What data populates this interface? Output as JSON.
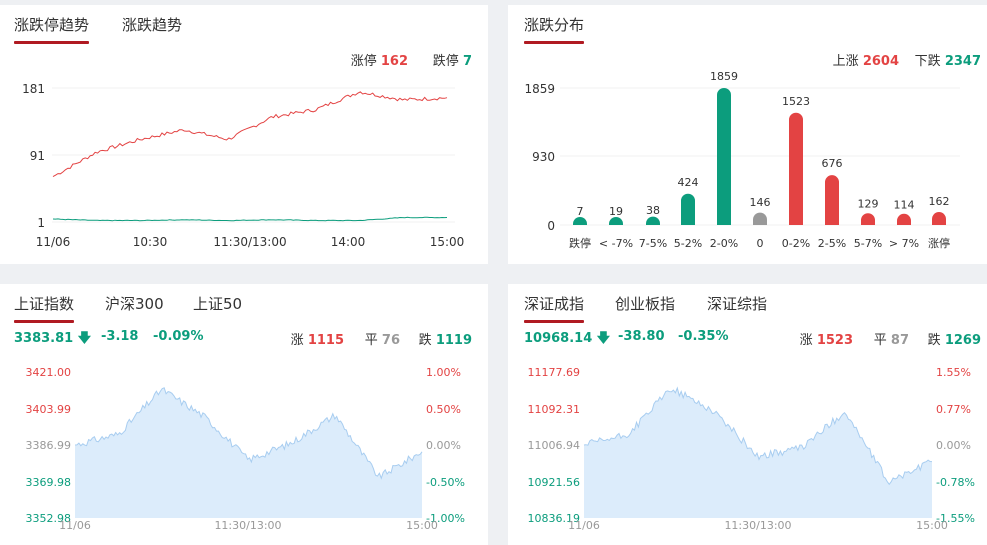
{
  "colors": {
    "red": "#e34343",
    "green": "#0c9d7d",
    "gray": "#999999",
    "accent": "#b01a22",
    "area_fill": "#dcecfb",
    "area_line": "#a8cdf0"
  },
  "limit_trend": {
    "tabs": [
      "涨跌停趋势",
      "涨跌趋势"
    ],
    "up_label": "涨停",
    "up_value": "162",
    "down_label": "跌停",
    "down_value": "7",
    "y_ticks": [
      "181",
      "91",
      "1"
    ],
    "x_ticks": [
      "11/06",
      "10:30",
      "11:30/13:00",
      "14:00",
      "15:00"
    ]
  },
  "distribution": {
    "tab": "涨跌分布",
    "up_label": "上涨",
    "up_value": "2604",
    "down_label": "下跌",
    "down_value": "2347",
    "y_ticks": [
      "1859",
      "930",
      "0"
    ]
  },
  "sh_index": {
    "tabs": [
      "上证指数",
      "沪深300",
      "上证50"
    ],
    "price": "3383.81",
    "change": "-3.18",
    "pct": "-0.09%",
    "up_label": "涨",
    "up_value": "1115",
    "flat_label": "平",
    "flat_value": "76",
    "down_label": "跌",
    "down_value": "1119",
    "left_ticks": [
      "3421.00",
      "3403.99",
      "3386.99",
      "3369.98",
      "3352.98"
    ],
    "right_ticks": [
      "1.00%",
      "0.50%",
      "0.00%",
      "-0.50%",
      "-1.00%"
    ],
    "x_ticks": [
      "11/06",
      "11:30/13:00",
      "15:00"
    ]
  },
  "sz_index": {
    "tabs": [
      "深证成指",
      "创业板指",
      "深证综指"
    ],
    "price": "10968.14",
    "change": "-38.80",
    "pct": "-0.35%",
    "up_label": "涨",
    "up_value": "1523",
    "flat_label": "平",
    "flat_value": "87",
    "down_label": "跌",
    "down_value": "1269",
    "left_ticks": [
      "11177.69",
      "11092.31",
      "11006.94",
      "10921.56",
      "10836.19"
    ],
    "right_ticks": [
      "1.55%",
      "0.77%",
      "0.00%",
      "-0.78%",
      "-1.55%"
    ],
    "x_ticks": [
      "11/06",
      "11:30/13:00",
      "15:00"
    ]
  },
  "chart_data": [
    {
      "type": "line",
      "title": "涨跌停趋势",
      "ylim": [
        1,
        181
      ],
      "x": [
        "09:30",
        "10:00",
        "10:30",
        "11:00",
        "11:30/13:00",
        "13:30",
        "14:00",
        "14:30",
        "14:45",
        "15:00"
      ],
      "series": [
        {
          "name": "涨停",
          "color": "#e34343",
          "values": [
            62,
            95,
            112,
            125,
            112,
            142,
            152,
            176,
            165,
            168
          ]
        },
        {
          "name": "跌停",
          "color": "#0c9d7d",
          "values": [
            5,
            3,
            3,
            4,
            3,
            4,
            3,
            3,
            7,
            7
          ]
        }
      ]
    },
    {
      "type": "bar",
      "title": "涨跌分布",
      "ylim": [
        0,
        1859
      ],
      "categories": [
        "跌停",
        "< -7%",
        "7-5%",
        "5-2%",
        "2-0%",
        "0",
        "0-2%",
        "2-5%",
        "5-7%",
        "> 7%",
        "涨停"
      ],
      "values": [
        7,
        19,
        38,
        424,
        1859,
        146,
        1523,
        676,
        129,
        114,
        162
      ],
      "bar_colors": [
        "#0c9d7d",
        "#0c9d7d",
        "#0c9d7d",
        "#0c9d7d",
        "#0c9d7d",
        "#999999",
        "#e34343",
        "#e34343",
        "#e34343",
        "#e34343",
        "#e34343"
      ]
    },
    {
      "type": "area",
      "title": "上证指数",
      "ylim": [
        3352.98,
        3421.0
      ],
      "x": [
        "09:30",
        "10:00",
        "10:30",
        "11:00",
        "11:30/13:00",
        "13:30",
        "14:00",
        "14:30",
        "15:00"
      ],
      "values": [
        3386.99,
        3392.0,
        3413.0,
        3400.0,
        3380.0,
        3388.0,
        3401.0,
        3372.0,
        3383.81
      ]
    },
    {
      "type": "area",
      "title": "深证成指",
      "ylim": [
        10836.19,
        11177.69
      ],
      "x": [
        "09:30",
        "10:00",
        "10:30",
        "11:00",
        "11:30/13:00",
        "13:30",
        "14:00",
        "14:30",
        "15:00"
      ],
      "values": [
        11006.94,
        11030.0,
        11140.0,
        11085.0,
        10980.0,
        11000.0,
        11085.0,
        10920.0,
        10968.14
      ]
    }
  ]
}
